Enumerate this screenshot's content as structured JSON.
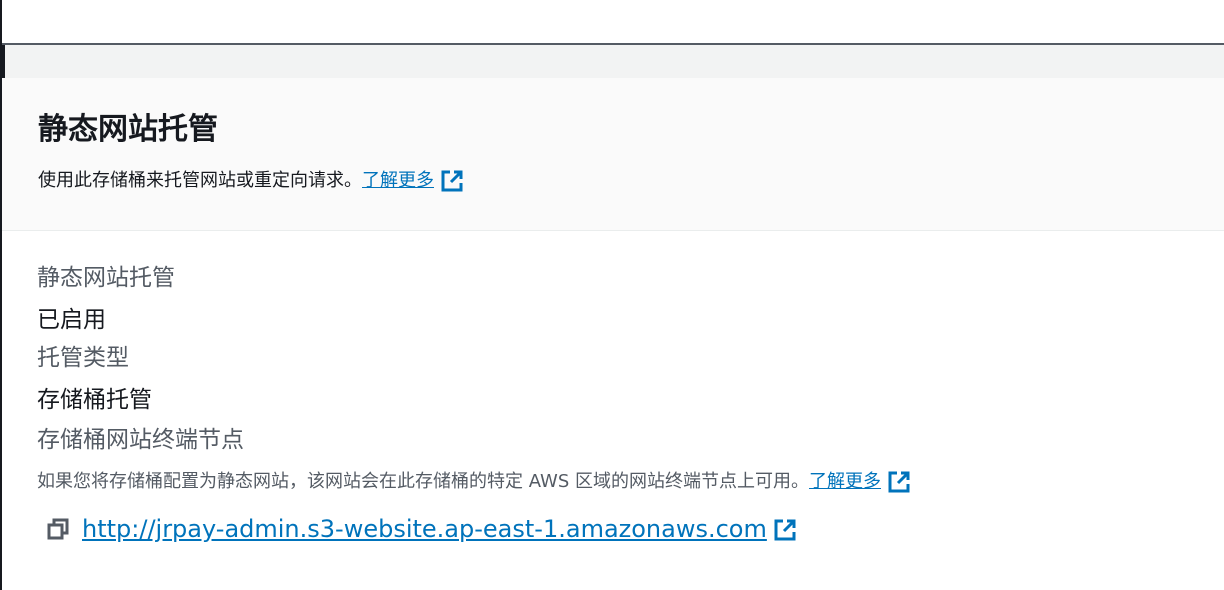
{
  "panel": {
    "title": "静态网站托管",
    "description": "使用此存储桶来托管网站或重定向请求。",
    "learn_more": "了解更多"
  },
  "fields": {
    "static_hosting_label": "静态网站托管",
    "static_hosting_value": "已启用",
    "hosting_type_label": "托管类型",
    "hosting_type_value": "存储桶托管",
    "endpoint_label": "存储桶网站终端节点",
    "endpoint_hint": "如果您将存储桶配置为静态网站，该网站会在此存储桶的特定 AWS 区域的网站终端节点上可用。",
    "endpoint_learn_more": "了解更多",
    "endpoint_url": "http://jrpay-admin.s3-website.ap-east-1.amazonaws.com"
  },
  "icons": {
    "external_link": "external-link-icon",
    "copy": "copy-icon"
  },
  "colors": {
    "link": "#0073bb",
    "text": "#16191f",
    "secondary_text": "#545b64",
    "header_bg": "#fafafa"
  }
}
